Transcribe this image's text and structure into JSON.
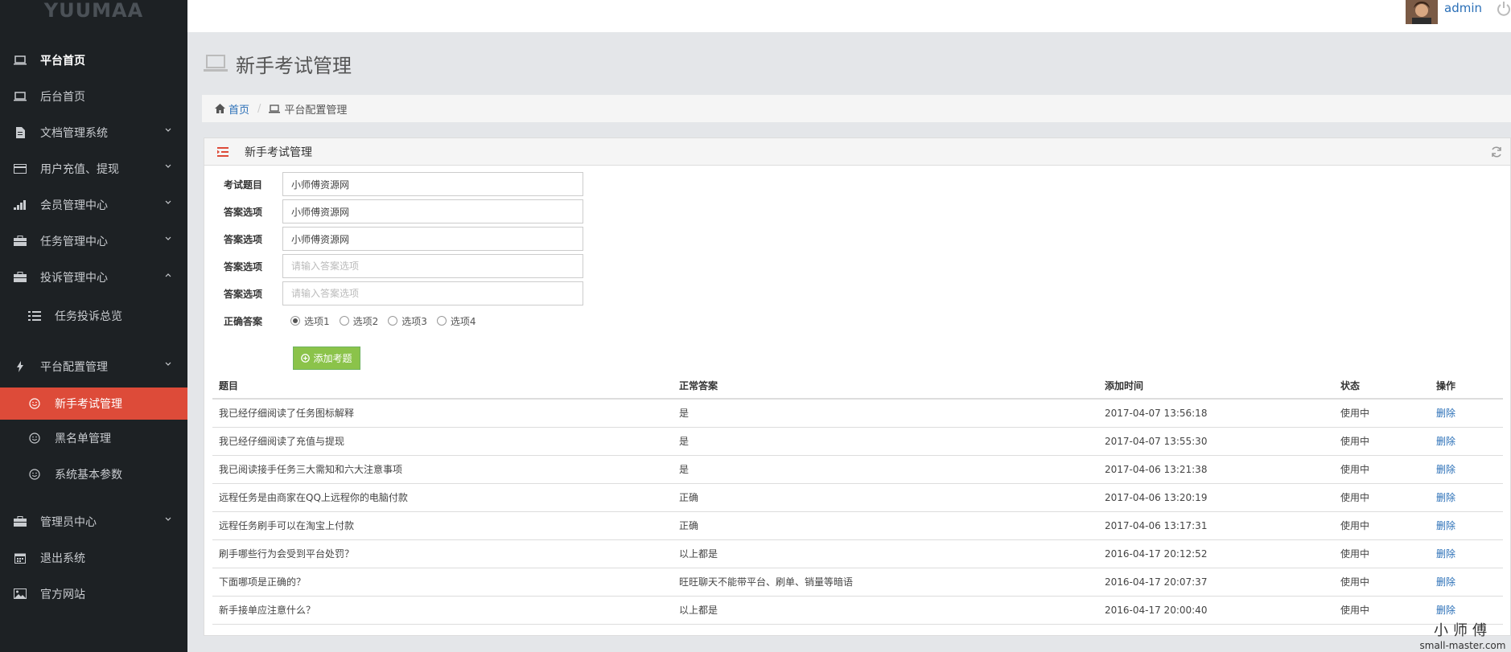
{
  "sidebar": {
    "logo": "YUUMAA",
    "items": [
      {
        "label": "平台首页",
        "icon": "laptop-icon"
      },
      {
        "label": "后台首页",
        "icon": "laptop-icon"
      },
      {
        "label": "文档管理系统",
        "icon": "file-icon"
      },
      {
        "label": "用户充值、提现",
        "icon": "credit-card-icon"
      },
      {
        "label": "会员管理中心",
        "icon": "signal-icon"
      },
      {
        "label": "任务管理中心",
        "icon": "briefcase-icon"
      },
      {
        "label": "投诉管理中心",
        "icon": "briefcase-icon"
      },
      {
        "label": "任务投诉总览",
        "icon": "list-icon"
      },
      {
        "label": "平台配置管理",
        "icon": "bolt-icon"
      },
      {
        "label": "新手考试管理",
        "icon": "smile-icon"
      },
      {
        "label": "黑名单管理",
        "icon": "smile-icon"
      },
      {
        "label": "系统基本参数",
        "icon": "smile-icon"
      },
      {
        "label": "管理员中心",
        "icon": "briefcase-icon"
      },
      {
        "label": "退出系统",
        "icon": "calendar-icon"
      },
      {
        "label": "官方网站",
        "icon": "picture-icon"
      }
    ]
  },
  "topbar": {
    "username": "admin"
  },
  "page": {
    "title": "新手考试管理"
  },
  "breadcrumb": {
    "home": "首页",
    "current": "平台配置管理"
  },
  "panel": {
    "title": "新手考试管理"
  },
  "form": {
    "question_label": "考试题目",
    "question_value": "小师傅资源网",
    "option_label": "答案选项",
    "option1_value": "小师傅资源网",
    "option2_value": "小师傅资源网",
    "option_placeholder": "请输入答案选项",
    "correct_label": "正确答案",
    "radios": [
      "选项1",
      "选项2",
      "选项3",
      "选项4"
    ],
    "add_button": "添加考题"
  },
  "table": {
    "headers": [
      "题目",
      "正常答案",
      "添加时间",
      "状态",
      "操作"
    ],
    "rows": [
      {
        "q": "我已经仔细阅读了任务图标解释",
        "a": "是",
        "t": "2017-04-07 13:56:18",
        "s": "使用中",
        "op": "删除"
      },
      {
        "q": "我已经仔细阅读了充值与提现",
        "a": "是",
        "t": "2017-04-07 13:55:30",
        "s": "使用中",
        "op": "删除"
      },
      {
        "q": "我已阅读接手任务三大需知和六大注意事项",
        "a": "是",
        "t": "2017-04-06 13:21:38",
        "s": "使用中",
        "op": "删除"
      },
      {
        "q": "远程任务是由商家在QQ上远程你的电脑付款",
        "a": "正确",
        "t": "2017-04-06 13:20:19",
        "s": "使用中",
        "op": "删除"
      },
      {
        "q": "远程任务刷手可以在淘宝上付款",
        "a": "正确",
        "t": "2017-04-06 13:17:31",
        "s": "使用中",
        "op": "删除"
      },
      {
        "q": "刷手哪些行为会受到平台处罚？",
        "a": "以上都是",
        "t": "2016-04-17 20:12:52",
        "s": "使用中",
        "op": "删除"
      },
      {
        "q": "下面哪项是正确的？",
        "a": "旺旺聊天不能带平台、刷单、销量等暗语",
        "t": "2016-04-17 20:07:37",
        "s": "使用中",
        "op": "删除"
      },
      {
        "q": "新手接单应注意什么？",
        "a": "以上都是",
        "t": "2016-04-17 20:00:40",
        "s": "使用中",
        "op": "删除"
      }
    ]
  },
  "watermark": {
    "cn": "小师傅",
    "url": "small-master.com"
  }
}
